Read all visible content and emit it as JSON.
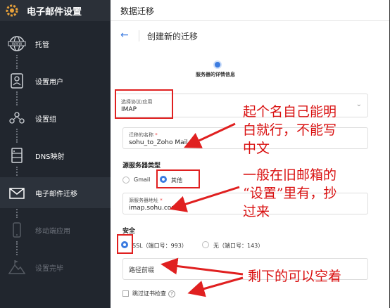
{
  "sidebar": {
    "title": "电子邮件设置",
    "items": [
      {
        "label": "托管",
        "icon": "globe-www-icon"
      },
      {
        "label": "设置用户",
        "icon": "user-card-icon"
      },
      {
        "label": "设置组",
        "icon": "group-icon"
      },
      {
        "label": "DNS映射",
        "icon": "server-icon"
      },
      {
        "label": "电子邮件迁移",
        "icon": "envelope-icon"
      },
      {
        "label": "移动端应用",
        "icon": "mobile-app-icon"
      },
      {
        "label": "设置完毕",
        "icon": "mountain-flag-icon"
      }
    ]
  },
  "header": {
    "title": "数据迁移"
  },
  "subheader": {
    "back_icon": "arrow-left-icon",
    "title": "创建新的迁移"
  },
  "stepper": {
    "label": "服务器的详情信息"
  },
  "form": {
    "protocol": {
      "label": "选择协议/应用",
      "value": "IMAP"
    },
    "migration_name": {
      "label": "迁移的名称",
      "required": "*",
      "value": "sohu_to_Zoho Mail"
    },
    "source_server_type": {
      "heading": "源服务器类型",
      "options": [
        {
          "label": "Gmail",
          "selected": false
        },
        {
          "label": "其他",
          "selected": true
        }
      ]
    },
    "source_server_address": {
      "label": "源服务器地址",
      "required": "*",
      "value": "imap.sohu.com"
    },
    "security": {
      "heading": "安全",
      "options": [
        {
          "label": "SSL（端口号：993）",
          "selected": true
        },
        {
          "label": "无（端口号：143）",
          "selected": false
        }
      ]
    },
    "path_prefix": {
      "placeholder": "路径前缀"
    },
    "skip_cert_check": {
      "label": "跳过证书检查",
      "checked": false
    }
  },
  "annotations": {
    "name_note": [
      "起个名自己能明",
      "白就行，不能写",
      "中文"
    ],
    "server_note": [
      "一般在旧邮箱的",
      "“设置”里有，抄",
      "过来"
    ],
    "rest_note": "剩下的可以空着"
  },
  "colors": {
    "accent": "#3b7be0",
    "annotation": "#d91010",
    "sidebar_bg": "#21262e"
  }
}
